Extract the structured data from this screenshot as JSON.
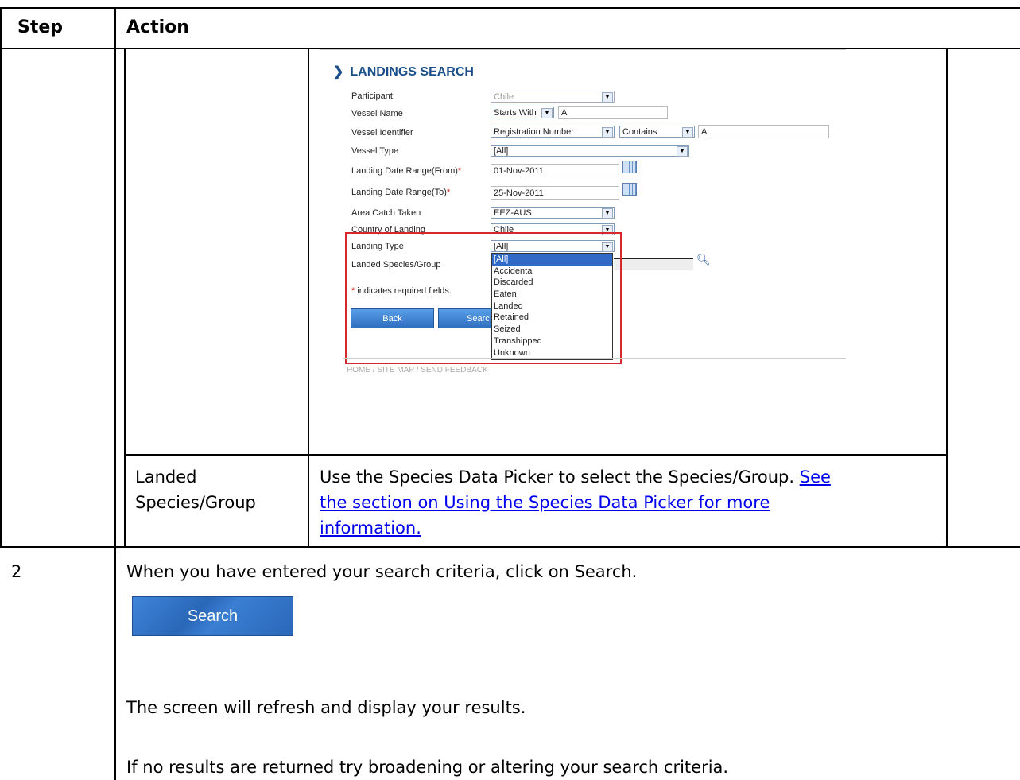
{
  "table": {
    "header": {
      "step": "Step",
      "action": "Action"
    },
    "row_species": {
      "label": "Landed Species/Group",
      "text": "Use the Species Data Picker to select the Species/Group. ",
      "link": "See the section on Using the Species Data Picker for more information."
    },
    "row2": {
      "step": "2",
      "instruction": "When you have entered your search criteria, click on Search.",
      "search_button": "Search",
      "refresh_note": "The screen will refresh and display your results.",
      "no_results_note": "If no results are returned try broadening or altering your search criteria."
    }
  },
  "screenshot": {
    "title": "LANDINGS SEARCH",
    "fields": {
      "participant": {
        "label": "Participant",
        "value": "Chile"
      },
      "vessel_name": {
        "label": "Vessel Name",
        "operator": "Starts With",
        "value": "A"
      },
      "vessel_identifier": {
        "label": "Vessel Identifier",
        "type": "Registration Number",
        "operator": "Contains",
        "value": "A"
      },
      "vessel_type": {
        "label": "Vessel Type",
        "value": "[All]"
      },
      "date_from": {
        "label": "Landing Date Range(From)",
        "value": "01-Nov-2011"
      },
      "date_to": {
        "label": "Landing Date Range(To)",
        "value": "25-Nov-2011"
      },
      "area_catch": {
        "label": "Area Catch Taken",
        "value": "EEZ-AUS"
      },
      "country_landing": {
        "label": "Country of Landing",
        "value": "Chile"
      },
      "landing_type": {
        "label": "Landing Type",
        "value": "[All]"
      },
      "species_group": {
        "label": "Landed Species/Group"
      }
    },
    "required_star": "*",
    "required_note": " indicates required fields.",
    "back_button": "Back",
    "search_button_partial": "Searc",
    "landing_type_options": [
      "[All]",
      "Accidental",
      "Discarded",
      "Eaten",
      "Landed",
      "Retained",
      "Seized",
      "Transhipped",
      "Unknown"
    ],
    "footer": "HOME / SITE MAP / SEND FEEDBACK"
  }
}
